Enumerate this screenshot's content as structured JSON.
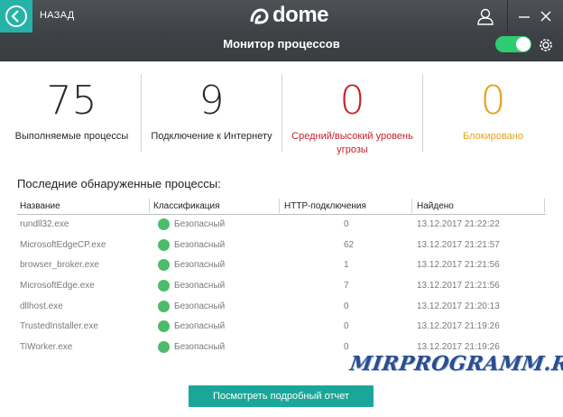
{
  "header": {
    "back_label": "НАЗАД",
    "logo_text": "dome",
    "title": "Монитор процессов",
    "accent": "#24b3a8",
    "toggle_on": true
  },
  "stats": [
    {
      "value": "75",
      "label": "Выполняемые процессы",
      "color": "#2a2a2a"
    },
    {
      "value": "9",
      "label": "Подключение к Интернету",
      "color": "#2a2a2a"
    },
    {
      "value": "0",
      "label": "Средний/высокий уровень угрозы",
      "color": "#c4242b"
    },
    {
      "value": "0",
      "label": "Блокировано",
      "color": "#e8a014"
    }
  ],
  "section_title": "Последние обнаруженные процессы:",
  "table": {
    "headers": [
      "Название",
      "Классификация",
      "HTTP-подключения",
      "Найдено"
    ],
    "rows": [
      {
        "name": "rundll32.exe",
        "class": "Безопасный",
        "http": "0",
        "found": "13.12.2017 21:22:22"
      },
      {
        "name": "MicrosoftEdgeCP.exe",
        "class": "Безопасный",
        "http": "62",
        "found": "13.12.2017 21:21:57"
      },
      {
        "name": "browser_broker.exe",
        "class": "Безопасный",
        "http": "1",
        "found": "13.12.2017 21:21:56"
      },
      {
        "name": "MicrosoftEdge.exe",
        "class": "Безопасный",
        "http": "7",
        "found": "13.12.2017 21:21:56"
      },
      {
        "name": "dllhost.exe",
        "class": "Безопасный",
        "http": "0",
        "found": "13.12.2017 21:20:13"
      },
      {
        "name": "TrustedInstaller.exe",
        "class": "Безопасный",
        "http": "0",
        "found": "13.12.2017 21:19:26"
      },
      {
        "name": "TiWorker.exe",
        "class": "Безопасный",
        "http": "0",
        "found": "13.12.2017 21:19:26"
      }
    ]
  },
  "report_button": "Посмотреть подробный отчет",
  "watermark": "MIRPROGRAMM.RU",
  "icons": {
    "back": "back-arrow-icon",
    "user": "user-icon",
    "minimize": "minimize-icon",
    "close": "close-icon",
    "settings": "gear-icon",
    "safe": "green-status-dot-icon"
  }
}
